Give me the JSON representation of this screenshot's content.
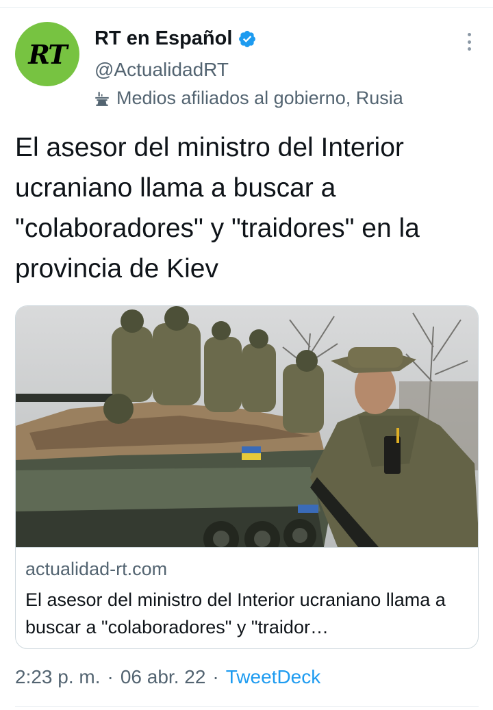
{
  "account": {
    "avatar_text": "RT",
    "display_name": "RT en Español",
    "handle": "@ActualidadRT",
    "affiliation": "Medios afiliados al gobierno, Rusia",
    "avatar_color": "#77c341",
    "verified_color": "#1d9bf0",
    "icons": {
      "verified": "verified-badge-icon",
      "affiliation": "podium-icon",
      "more": "more-vertical-icon"
    }
  },
  "tweet": {
    "text": "El asesor del ministro del Interior ucraniano llama a buscar a \"colaboradores\" y \"traidores\" en la provincia de Kiev"
  },
  "card": {
    "domain": "actualidad-rt.com",
    "title": "El asesor del ministro del Interior ucraniano llama a buscar a \"colaboradores\" y \"traidor…"
  },
  "footer": {
    "time": "2:23 p. m.",
    "separator": "·",
    "date": "06 abr. 22",
    "source": "TweetDeck",
    "link_color": "#1d9bf0"
  }
}
